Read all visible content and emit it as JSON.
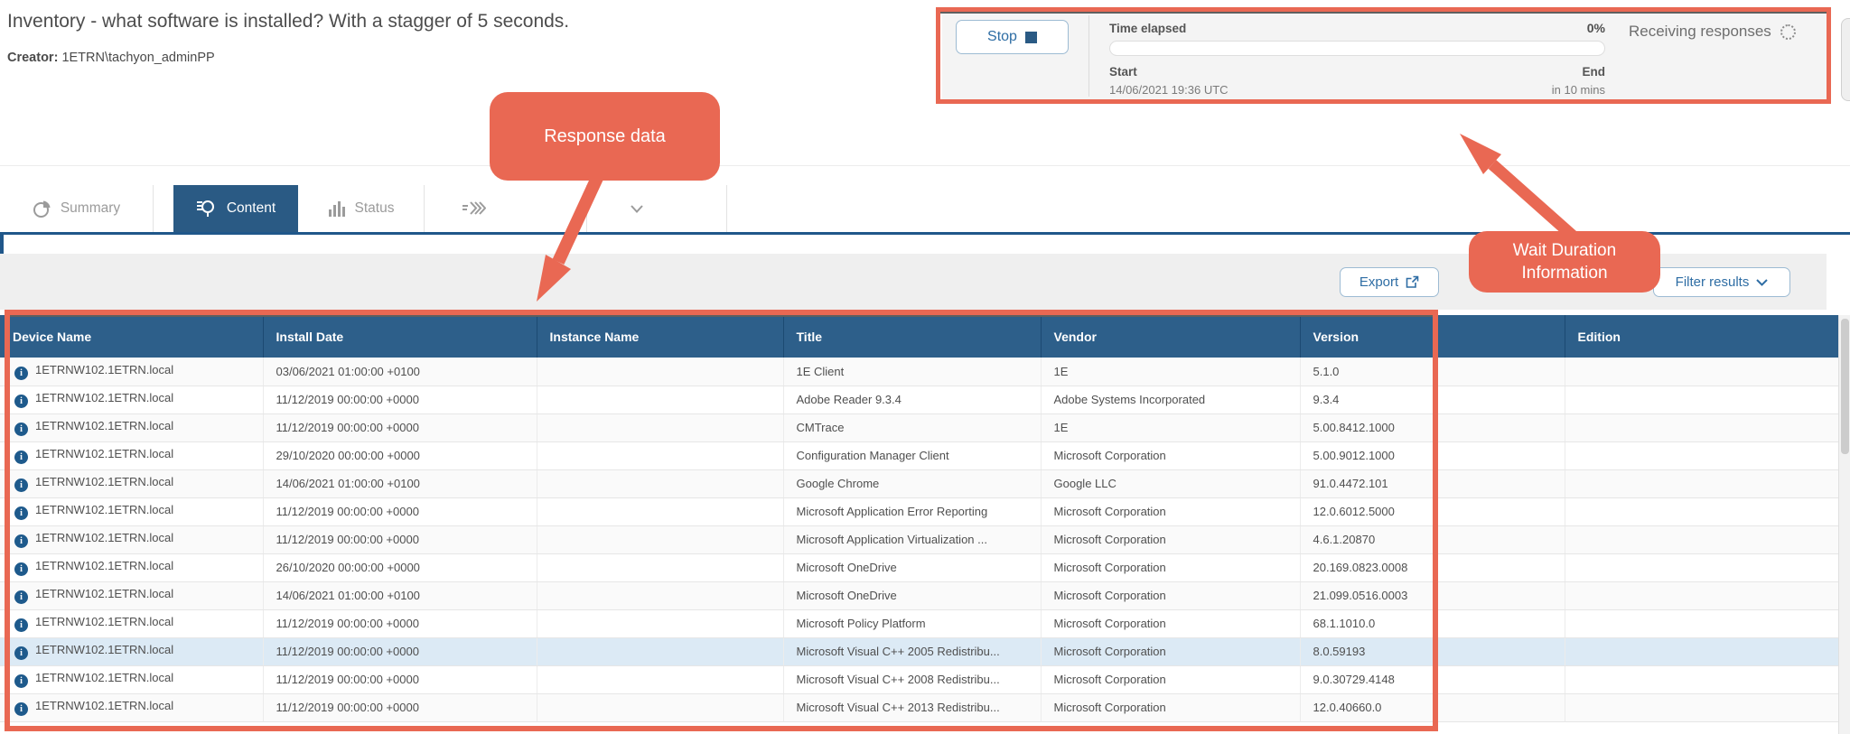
{
  "header": {
    "title": "Inventory - what software is installed? With a stagger of 5 seconds.",
    "creator_label": "Creator:",
    "creator_value": "1ETRN\\tachyon_adminPP"
  },
  "status_panel": {
    "stop_label": "Stop",
    "time_elapsed_label": "Time elapsed",
    "percent": "0%",
    "receiving_label": "Receiving responses",
    "start_label": "Start",
    "start_value": "14/06/2021 19:36 UTC",
    "end_label": "End",
    "end_value": "in 10 mins"
  },
  "tabs": [
    {
      "label": "Summary",
      "icon": "pie-chart-icon",
      "active": false
    },
    {
      "label": "Content",
      "icon": "search-list-icon",
      "active": true
    },
    {
      "label": "Status",
      "icon": "bar-chart-icon",
      "active": false
    },
    {
      "label": "",
      "icon": "push-icon",
      "active": false
    },
    {
      "label": "",
      "icon": "chevron-down-icon",
      "active": false
    }
  ],
  "toolbar": {
    "export_label": "Export",
    "filter_label": "Filter results"
  },
  "table": {
    "columns": [
      "Device Name",
      "Install Date",
      "Instance Name",
      "Title",
      "Vendor",
      "Version",
      "Edition"
    ],
    "highlighted_row_index": 10,
    "rows": [
      [
        "1ETRNW102.1ETRN.local",
        "03/06/2021 01:00:00 +0100",
        "",
        "1E Client",
        "1E",
        "5.1.0",
        ""
      ],
      [
        "1ETRNW102.1ETRN.local",
        "11/12/2019 00:00:00 +0000",
        "",
        "Adobe Reader 9.3.4",
        "Adobe Systems Incorporated",
        "9.3.4",
        ""
      ],
      [
        "1ETRNW102.1ETRN.local",
        "11/12/2019 00:00:00 +0000",
        "",
        "CMTrace",
        "1E",
        "5.00.8412.1000",
        ""
      ],
      [
        "1ETRNW102.1ETRN.local",
        "29/10/2020 00:00:00 +0000",
        "",
        "Configuration Manager Client",
        "Microsoft Corporation",
        "5.00.9012.1000",
        ""
      ],
      [
        "1ETRNW102.1ETRN.local",
        "14/06/2021 01:00:00 +0100",
        "",
        "Google Chrome",
        "Google LLC",
        "91.0.4472.101",
        ""
      ],
      [
        "1ETRNW102.1ETRN.local",
        "11/12/2019 00:00:00 +0000",
        "",
        "Microsoft Application Error Reporting",
        "Microsoft Corporation",
        "12.0.6012.5000",
        ""
      ],
      [
        "1ETRNW102.1ETRN.local",
        "11/12/2019 00:00:00 +0000",
        "",
        "Microsoft Application Virtualization ...",
        "Microsoft Corporation",
        "4.6.1.20870",
        ""
      ],
      [
        "1ETRNW102.1ETRN.local",
        "26/10/2020 00:00:00 +0000",
        "",
        "Microsoft OneDrive",
        "Microsoft Corporation",
        "20.169.0823.0008",
        ""
      ],
      [
        "1ETRNW102.1ETRN.local",
        "14/06/2021 01:00:00 +0100",
        "",
        "Microsoft OneDrive",
        "Microsoft Corporation",
        "21.099.0516.0003",
        ""
      ],
      [
        "1ETRNW102.1ETRN.local",
        "11/12/2019 00:00:00 +0000",
        "",
        "Microsoft Policy Platform",
        "Microsoft Corporation",
        "68.1.1010.0",
        ""
      ],
      [
        "1ETRNW102.1ETRN.local",
        "11/12/2019 00:00:00 +0000",
        "",
        "Microsoft Visual C++ 2005 Redistribu...",
        "Microsoft Corporation",
        "8.0.59193",
        ""
      ],
      [
        "1ETRNW102.1ETRN.local",
        "11/12/2019 00:00:00 +0000",
        "",
        "Microsoft Visual C++ 2008 Redistribu...",
        "Microsoft Corporation",
        "9.0.30729.4148",
        ""
      ],
      [
        "1ETRNW102.1ETRN.local",
        "11/12/2019 00:00:00 +0000",
        "",
        "Microsoft Visual C++ 2013 Redistribu...",
        "Microsoft Corporation",
        "12.0.40660.0",
        ""
      ]
    ]
  },
  "annotations": {
    "color": "#e96853",
    "response_callout": "Response data",
    "wait_callout_line1": "Wait Duration",
    "wait_callout_line2": "Information"
  }
}
